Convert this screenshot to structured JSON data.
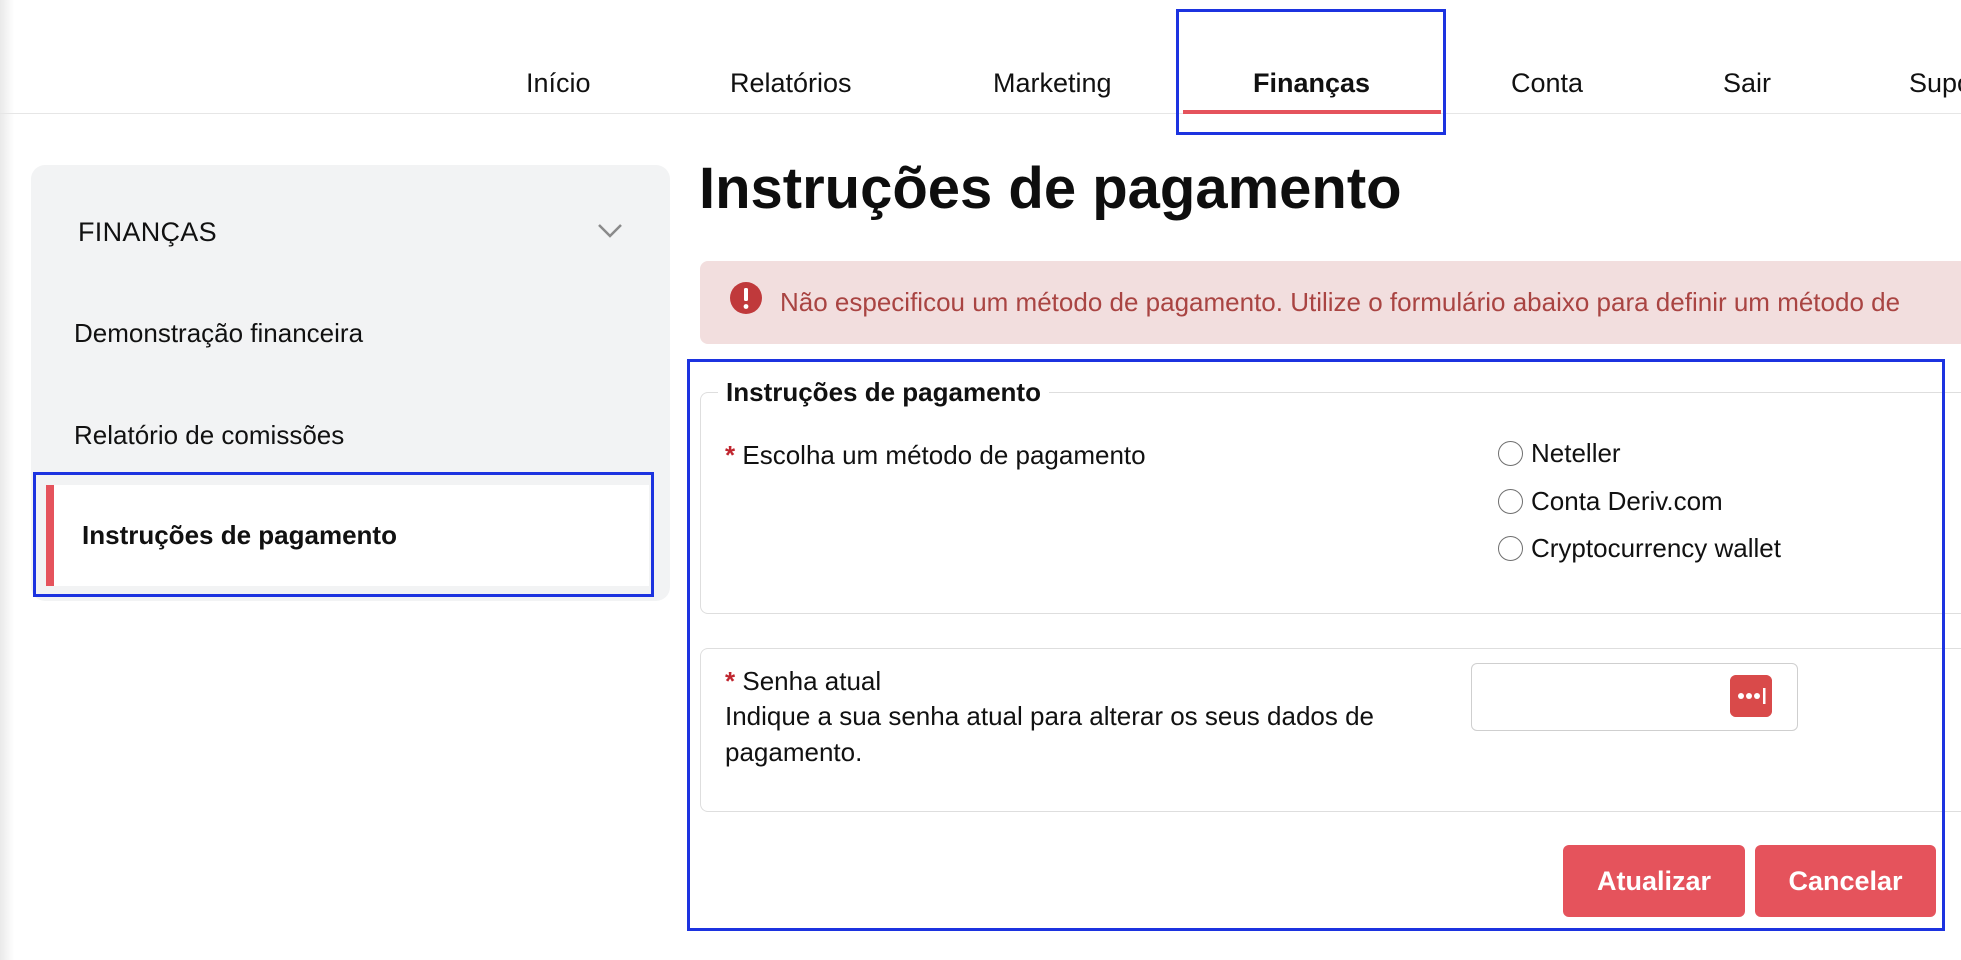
{
  "nav": {
    "items": [
      {
        "label": "Início"
      },
      {
        "label": "Relatórios"
      },
      {
        "label": "Marketing"
      },
      {
        "label": "Finanças"
      },
      {
        "label": "Conta"
      },
      {
        "label": "Sair"
      },
      {
        "label": "Supo"
      }
    ],
    "active": "Finanças"
  },
  "sidebar": {
    "header": "FINANÇAS",
    "items": [
      {
        "label": "Demonstração financeira"
      },
      {
        "label": "Relatório de comissões"
      },
      {
        "label": "Instruções de pagamento"
      }
    ],
    "active": "Instruções de pagamento"
  },
  "main": {
    "title": "Instruções de pagamento",
    "alert": "Não especificou um método de pagamento. Utilize o formulário abaixo para definir um método de",
    "fieldset": {
      "legend": "Instruções de pagamento",
      "method_label": "Escolha um método de pagamento",
      "required_mark": "*",
      "options": [
        {
          "label": "Neteller"
        },
        {
          "label": "Conta Deriv.com"
        },
        {
          "label": "Cryptocurrency wallet"
        }
      ]
    },
    "password": {
      "label": "Senha atual",
      "help": "Indique a sua senha atual para alterar os seus dados de pagamento.",
      "value": ""
    },
    "buttons": {
      "update": "Atualizar",
      "cancel": "Cancelar"
    }
  },
  "colors": {
    "accent": "#e5535c",
    "highlight_box": "#1c33e0",
    "alert_bg": "#f2dede",
    "alert_text": "#a94442"
  }
}
